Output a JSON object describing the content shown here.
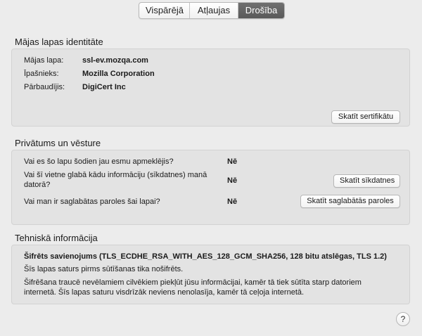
{
  "tabs": [
    {
      "label": "Vispārējā",
      "selected": false
    },
    {
      "label": "Atļaujas",
      "selected": false
    },
    {
      "label": "Drošība",
      "selected": true
    }
  ],
  "identity": {
    "title": "Mājas lapas identitāte",
    "website_label": "Mājas lapa:",
    "website_value": "ssl-ev.mozqa.com",
    "owner_label": "Īpašnieks:",
    "owner_value": "Mozilla Corporation",
    "verifier_label": "Pārbaudījis:",
    "verifier_value": "DigiCert Inc",
    "view_cert_button": "Skatīt sertifikātu"
  },
  "privacy": {
    "title": "Privātums un vēsture",
    "q1": "Vai es šo lapu šodien jau esmu apmeklējis?",
    "a1": "Nē",
    "q2_line1": "Vai šī vietne glabā kādu informāciju (sīkdatnes) manā",
    "q2_line2": "datorā?",
    "a2": "Nē",
    "view_cookies_button": "Skatīt sīkdatnes",
    "q3": "Vai man ir saglabātas paroles šai lapai?",
    "a3": "Nē",
    "view_passwords_button": "Skatīt saglabātās paroles"
  },
  "technical": {
    "title": "Tehniskā informācija",
    "line1": "Šifrēts savienojums (TLS_ECDHE_RSA_WITH_AES_128_GCM_SHA256, 128 bitu atslēgas, TLS 1.2)",
    "line2": "Šīs lapas saturs pirms sūtīšanas tika nošifrēts.",
    "line3": "Šifrēšana traucē nevēlamiem cilvēkiem piekļūt jūsu informācijai, kamēr tā tiek sūtīta starp datoriem",
    "line4": "internetā. Šīs lapas saturu visdrīzāk neviens nenolasīja, kamēr tā ceļoja internetā."
  },
  "help": {
    "label": "?"
  }
}
